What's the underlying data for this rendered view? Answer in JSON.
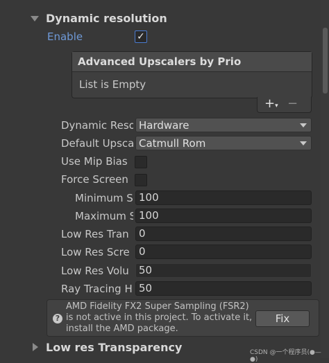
{
  "dynamic_resolution": {
    "title": "Dynamic resolution",
    "enable_label": "Enable",
    "enable_checked": true,
    "upscalers_list": {
      "header": "Advanced Upscalers by Prio",
      "empty_text": "List is Empty",
      "add_label": "+",
      "add_menu_glyph": "▾",
      "remove_label": "−"
    },
    "rows": [
      {
        "label": "Dynamic Reso",
        "type": "dropdown",
        "value": "Hardware"
      },
      {
        "label": "Default Upsca",
        "type": "dropdown",
        "value": "Catmull Rom"
      },
      {
        "label": "Use Mip Bias",
        "type": "checkbox",
        "checked": false
      },
      {
        "label": "Force Screen",
        "type": "checkbox",
        "checked": false
      },
      {
        "label": "Minimum S",
        "type": "field",
        "value": "100"
      },
      {
        "label": "Maximum S",
        "type": "field",
        "value": "100"
      },
      {
        "label": "Low Res Tran",
        "type": "field",
        "value": "0"
      },
      {
        "label": "Low Res Scre",
        "type": "field",
        "value": "0"
      },
      {
        "label": "Low Res Volu",
        "type": "field",
        "value": "50"
      },
      {
        "label": "Ray Tracing H",
        "type": "field",
        "value": "50"
      }
    ],
    "help": {
      "icon": "question-icon",
      "line1": "AMD Fidelity FX2 Super Sampling (FSR2)",
      "line2": "is not active in this project. To activate it,",
      "line3": "install the AMD package.",
      "button_label": "Fix"
    }
  },
  "low_res_transparency": {
    "title": "Low res Transparency"
  },
  "watermark": "CSDN @一个程序员(●—●)"
}
